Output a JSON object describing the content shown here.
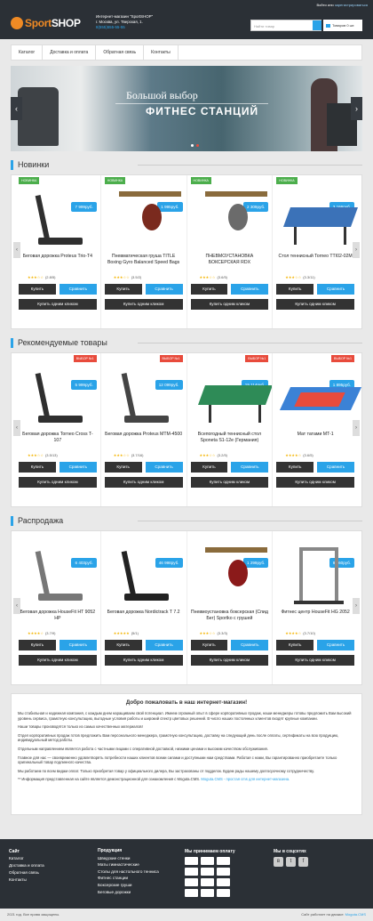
{
  "topbar": {
    "login": "Войти",
    "sep": " или ",
    "register": "зарегистрироваться"
  },
  "header": {
    "logo_a": "Sport",
    "logo_b": "SHOP",
    "line1": "Интернет-магазин \"SportSHOP\"",
    "line2": "г. Москва, ул. Тверская, 1.",
    "phone": "8(555)555-55-55",
    "search_placeholder": "Найти товар",
    "cart": "Товаров 0 шт."
  },
  "nav": [
    "Каталог",
    "Доставка и оплата",
    "Обратная связь",
    "Контакты"
  ],
  "slider": {
    "line1": "Большой выбор",
    "line2": "ФИТНЕС СТАНЦИЙ"
  },
  "sections": [
    {
      "title": "Новинки",
      "products": [
        {
          "badge": "НОВИНКА",
          "price": "7 999руб.",
          "name": "Беговая дорожка Proteus Trio-T4",
          "stars": "★★★☆☆",
          "votes": "(2.8/5)"
        },
        {
          "badge": "НОВИНКА",
          "price": "1 995руб.",
          "name": "Пневматическая груша TITLE Boxing Gyro Balanced Speed Bags",
          "stars": "★★★☆☆",
          "votes": "(3.5/2)"
        },
        {
          "badge": "НОВИНКА",
          "price": "2 309руб.",
          "name": "ПНЕВМОУСТАНОВКА БОКСЕРСКАЯ RDX",
          "stars": "★★★☆☆",
          "votes": "(3.6/5)"
        },
        {
          "badge": "НОВИНКА",
          "price": "3 166руб.",
          "name": "Стол теннисный Torneo TTI02-02M",
          "stars": "★★★☆☆",
          "votes": "(3.3/11)"
        }
      ]
    },
    {
      "title": "Рекомендуемые товары",
      "products": [
        {
          "badge": "ВЫБОР №1",
          "price": "5 999руб.",
          "name": "Беговая дорожка Torneo Cross T-107",
          "stars": "★★★☆☆",
          "votes": "(3.5/13)"
        },
        {
          "badge": "ВЫБОР №1",
          "price": "12 099руб.",
          "name": "Беговая дорожка Proteus MTM-4500",
          "stars": "★★★☆☆",
          "votes": "(3.7/16)"
        },
        {
          "badge": "ВЫБОР №1",
          "price": "15 114руб.",
          "name": "Всепогодный теннисный стол Sponeta S1-12e (Германия)",
          "stars": "★★★☆☆",
          "votes": "(3.2/5)"
        },
        {
          "badge": "ВЫБОР №1",
          "price": "1 895руб.",
          "name": "Мат татами MT-1",
          "stars": "★★★★☆",
          "votes": "(3.6/5)"
        }
      ]
    },
    {
      "title": "Распродажа",
      "products": [
        {
          "badge": "",
          "price": "6 403руб.",
          "name": "Беговая дорожка HouseFit HT 9052 HP",
          "stars": "★★★★☆",
          "votes": "(3.7/9)"
        },
        {
          "badge": "",
          "price": "46 998руб.",
          "name": "Беговая дорожка Nordictrack T 7.2",
          "stars": "★★★★★",
          "votes": "(5/1)"
        },
        {
          "badge": "",
          "price": "1 299руб.",
          "name": "Пневмоустановка боксерская (Спид Бег) Sportko с грушей",
          "stars": "★★★☆☆",
          "votes": "(3.3/3)"
        },
        {
          "badge": "",
          "price": "9 360руб.",
          "name": "Фитнес центр HouseFit HG 2052",
          "stars": "★★★★☆",
          "votes": "(3.7/10)"
        }
      ]
    }
  ],
  "buttons": {
    "buy": "Купить",
    "compare": "Сравнить",
    "one_click": "Купить одним кликом"
  },
  "about": {
    "title": "Добро пожаловать в наш интернет-магазин!",
    "p1": "Мы стабильная и надежная компания, с каждым днем наращиваем свой потенциал. Имеем огромный опыт в сфере корпоративных продаж, наши менеджеры готовы предложить Вам высокий уровень сервиса, грамотную консультацию, выгодные условия работы и широкий спектр цветовых решений. В число наших постоянных клиентов входят крупные компании.",
    "p2": "Наши товары производятся только из самых качественных материалов!",
    "p3": "Отдел корпоративных продаж готов предложить Вам персонального менеджера, грамотную консультацию, доставку на следующий день после оплаты, сертификаты на всю продукцию, индивидуальный метод работы.",
    "p4": "Отдельным направлением является работа с частными лицами с оперативной доставкой, низкими ценами и высоким качеством обслуживания.",
    "p5": "Главное для нас — своевременно удовлетворять потребности наших клиентов всеми силами и доступными нам средствами. Работая с нами, Вы гарантированно приобретаете только оригинальный товар подлинного качества.",
    "p6": "Мы работаем по всем видам оплат. Только приобретая товар у официального дилера, Вы застрахованы от подделок. Будем рады нашему долгосрочному сотрудничеству.",
    "note": "** Информация представленная на сайте является демонстрационной для ознакомления с Moguta.CMS.",
    "note_link": "Moguta.CMS - простая cms для интернет-магазина."
  },
  "footer": {
    "col1": {
      "title": "Сайт",
      "items": [
        "Каталог",
        "Доставка и оплата",
        "Обратная связь",
        "Контакты"
      ]
    },
    "col2": {
      "title": "Продукция",
      "items": [
        "Шведские стенки",
        "Маты гимнастические",
        "Столы для настольного тенниса",
        "Фитнес станции",
        "Боксерские груши",
        "Беговые дорожки"
      ]
    },
    "col3": {
      "title": "Мы принимаем оплату"
    },
    "col4": {
      "title": "Мы в соцсетях",
      "icons": [
        "vk-icon",
        "twitter-icon",
        "facebook-icon"
      ]
    },
    "copyright": "2021 год. Все права защищены.",
    "made_by": "Сайт работает на движке: ",
    "made_by_link": "Moguta.CMS"
  }
}
